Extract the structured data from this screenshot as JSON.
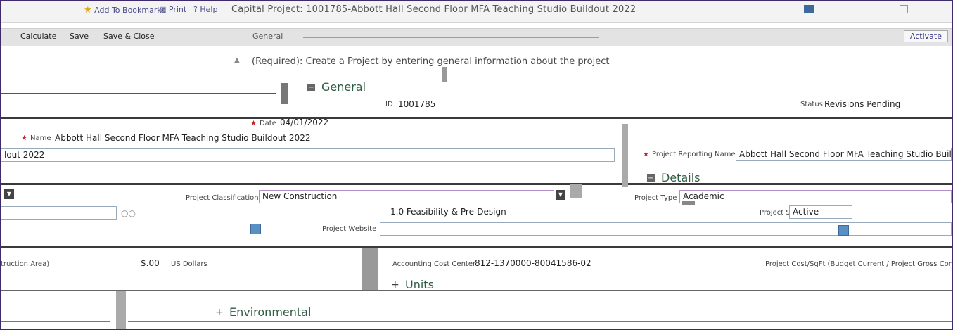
{
  "titlebar": {
    "add_bookmarks": "Add To Bookmarks",
    "print": "Print",
    "help": "Help",
    "title": "Capital Project: 1001785-Abbott Hall Second Floor MFA Teaching Studio Buildout 2022"
  },
  "toolbar": {
    "calculate": "Calculate",
    "save": "Save",
    "save_close": "Save & Close",
    "general_tab": "General",
    "activate": "Activate"
  },
  "notice": "(Required): Create a Project by entering general information about the project",
  "sections": {
    "general": "General",
    "details": "Details",
    "units": "Units",
    "environmental": "Environmental"
  },
  "general": {
    "id_label": "ID",
    "id_value": "1001785",
    "status_label": "Status",
    "status_value": "Revisions Pending",
    "date_label": "Date",
    "date_value": "04/01/2022",
    "name_label": "Name",
    "name_value": "Abbott Hall Second Floor MFA Teaching Studio Buildout 2022",
    "name_value_tail": "lout 2022",
    "reporting_label": "Project Reporting Name",
    "reporting_value": "Abbott Hall Second Floor MFA Teaching Studio Build"
  },
  "details": {
    "classification_label": "Project Classification",
    "classification_value": "New Construction",
    "type_label": "Project Type",
    "type_value": "Academic",
    "phase_value": "1.0 Feasibility & Pre-Design",
    "state_label": "Project State",
    "state_value": "Active",
    "website_label": "Project Website",
    "accounting_label": "Accounting Cost Center",
    "accounting_value": "812-1370000-80041586-02",
    "construction_area_label": "truction Area)",
    "amount_value": "$.00",
    "currency": "US Dollars",
    "cost_sqft_label": "Project Cost/SqFt (Budget Current / Project Gross Cons"
  },
  "colors": {
    "accent": "#2f5d44",
    "required": "#c0282e",
    "frame": "#3d2a6b",
    "field_border": "#9ab"
  }
}
